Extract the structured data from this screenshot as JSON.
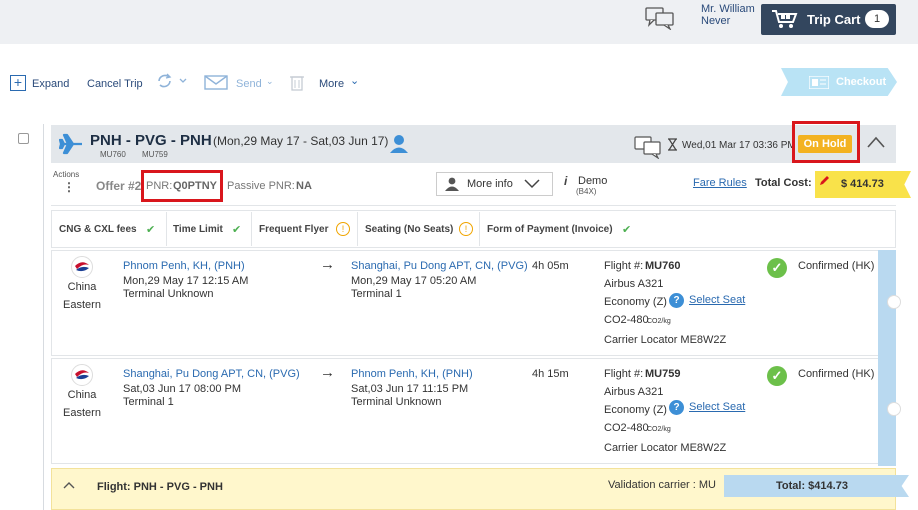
{
  "header": {
    "user_line1": "Mr. William",
    "user_line2": "Never",
    "trip_cart_label": "Trip Cart",
    "trip_cart_count": "1",
    "icons": [
      "chat-icon",
      "cart-icon"
    ]
  },
  "toolbar": {
    "expand": "Expand",
    "cancel_trip": "Cancel Trip",
    "send": "Send",
    "more": "More",
    "checkout": "Checkout"
  },
  "trip": {
    "route": "PNH - PVG - PNH",
    "dates": "(Mon,29 May 17 - Sat,03 Jun 17)",
    "flight1": "MU760",
    "flight2": "MU759",
    "timestamp": "Wed,01 Mar 17 03:36 PM",
    "status": "On Hold"
  },
  "offer": {
    "actions_label": "Actions",
    "offer_no": "Offer #2",
    "pnr_label": "PNR:",
    "pnr_value": "Q0PTNY",
    "passive_label": "Passive PNR:",
    "passive_value": "NA",
    "more_info": "More info",
    "demo": "Demo",
    "demo_code": "(B4X)",
    "fare_rules": "Fare Rules",
    "total_cost_label": "Total Cost:",
    "total_cost": "$ 414.73"
  },
  "rules": [
    {
      "label": "CNG & CXL fees",
      "state": "ok"
    },
    {
      "label": "Time Limit",
      "state": "ok"
    },
    {
      "label": "Frequent Flyer",
      "state": "warn"
    },
    {
      "label": "Seating (No Seats)",
      "state": "warn"
    },
    {
      "label": "Form of Payment (Invoice)",
      "state": "ok"
    }
  ],
  "segments": [
    {
      "airline_line1": "China",
      "airline_line2": "Eastern",
      "from": "Phnom Penh, KH, (PNH)",
      "from_time": "Mon,29 May 17 12:15 AM",
      "from_terminal": "Terminal Unknown",
      "arrow": "→",
      "to": "Shanghai, Pu Dong APT, CN, (PVG)",
      "to_time": "Mon,29 May 17 05:20 AM",
      "to_terminal": "Terminal 1",
      "duration": "4h 05m",
      "flight_label": "Flight #:",
      "flight": "MU760",
      "aircraft": "Airbus A321",
      "cabin": "Economy (Z)",
      "select_seat": "Select Seat",
      "co2": "CO2-480",
      "co2_unit": "CO2/kg",
      "locator": "Carrier Locator ME8W2Z",
      "status": "Confirmed (HK)"
    },
    {
      "airline_line1": "China",
      "airline_line2": "Eastern",
      "from": "Shanghai, Pu Dong APT, CN, (PVG)",
      "from_time": "Sat,03 Jun 17 08:00 PM",
      "from_terminal": "Terminal 1",
      "arrow": "→",
      "to": "Phnom Penh, KH, (PNH)",
      "to_time": "Sat,03 Jun 17 11:15 PM",
      "to_terminal": "Terminal Unknown",
      "duration": "4h 15m",
      "flight_label": "Flight #:",
      "flight": "MU759",
      "aircraft": "Airbus A321",
      "cabin": "Economy (Z)",
      "select_seat": "Select Seat",
      "co2": "CO2-480",
      "co2_unit": "CO2/kg",
      "locator": "Carrier Locator ME8W2Z",
      "status": "Confirmed (HK)"
    }
  ],
  "summary": {
    "flight_label": "Flight: PNH - PVG - PNH",
    "validation": "Validation carrier : MU",
    "total": "Total: $414.73"
  },
  "colors": {
    "accent": "#2a6ab0",
    "cart_bg": "#33465e",
    "hold": "#f3b221",
    "highlight_box": "#d9161c",
    "cost_tag": "#f9e24a"
  }
}
